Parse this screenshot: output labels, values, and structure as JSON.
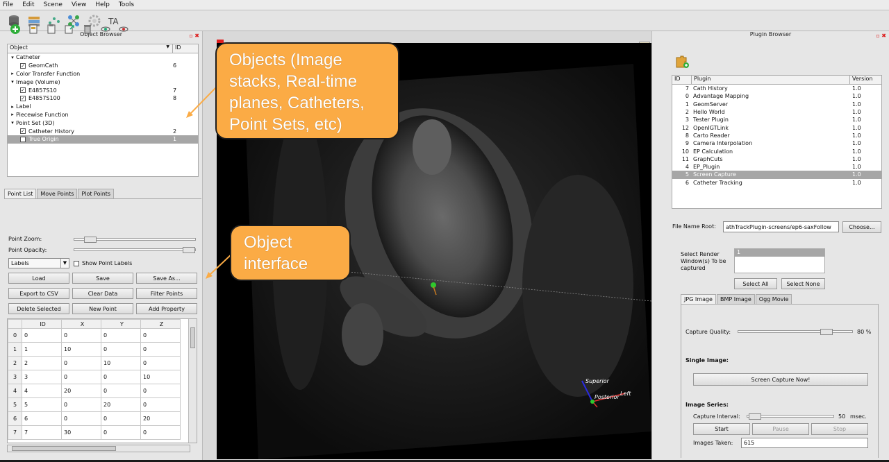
{
  "menu": [
    "File",
    "Edit",
    "Scene",
    "View",
    "Help",
    "Tools"
  ],
  "object_browser": {
    "title": "Object Browser",
    "columns": [
      "Object",
      "ID"
    ],
    "tree": [
      {
        "label": "Catheter",
        "level": 0,
        "arrow": "▾",
        "check": "",
        "id": ""
      },
      {
        "label": "GeomCath",
        "level": 1,
        "arrow": "",
        "check": "✓",
        "id": "6"
      },
      {
        "label": "Color Transfer Function",
        "level": 0,
        "arrow": "▸",
        "check": "",
        "id": ""
      },
      {
        "label": "Image (Volume)",
        "level": 0,
        "arrow": "▾",
        "check": "",
        "id": ""
      },
      {
        "label": "E4857S10",
        "level": 1,
        "arrow": "",
        "check": "✓",
        "id": "7"
      },
      {
        "label": "E4857S100",
        "level": 1,
        "arrow": "",
        "check": "✓",
        "id": "8"
      },
      {
        "label": "Label",
        "level": 0,
        "arrow": "▸",
        "check": "",
        "id": ""
      },
      {
        "label": "Piecewise Function",
        "level": 0,
        "arrow": "▸",
        "check": "",
        "id": ""
      },
      {
        "label": "Point Set (3D)",
        "level": 0,
        "arrow": "▾",
        "check": "",
        "id": ""
      },
      {
        "label": "Catheter History",
        "level": 1,
        "arrow": "",
        "check": "✓",
        "id": "2"
      },
      {
        "label": "True Origin",
        "level": 1,
        "arrow": "",
        "check": " ",
        "id": "1",
        "selected": true
      }
    ]
  },
  "point_panel": {
    "tabs": [
      "Point List",
      "Move Points",
      "Plot Points"
    ],
    "point_zoom_label": "Point Zoom:",
    "point_opacity_label": "Point Opacity:",
    "labels_combo": "Labels",
    "show_labels": "Show Point Labels",
    "buttons": {
      "load": "Load",
      "save": "Save",
      "save_as": "Save As...",
      "export_csv": "Export to CSV",
      "clear": "Clear Data",
      "filter": "Filter Points",
      "delete": "Delete Selected",
      "new_point": "New Point",
      "add_property": "Add Property"
    },
    "table": {
      "headers": [
        "ID",
        "X",
        "Y",
        "Z"
      ],
      "rows": [
        [
          "0",
          "0",
          "0",
          "0",
          "0"
        ],
        [
          "1",
          "1",
          "10",
          "0",
          "0"
        ],
        [
          "2",
          "2",
          "0",
          "10",
          "0"
        ],
        [
          "3",
          "3",
          "0",
          "0",
          "10"
        ],
        [
          "4",
          "4",
          "20",
          "0",
          "0"
        ],
        [
          "5",
          "5",
          "0",
          "20",
          "0"
        ],
        [
          "6",
          "6",
          "0",
          "0",
          "20"
        ],
        [
          "7",
          "7",
          "30",
          "0",
          "0"
        ]
      ]
    }
  },
  "viewport": {
    "orientation": {
      "superior": "Superior",
      "posterior": "Posterior",
      "left": "Left"
    }
  },
  "callouts": {
    "objects": [
      "Objects (Image",
      "stacks, Real-time",
      "planes, Catheters,",
      "Point Sets, etc)"
    ],
    "interface": [
      "Object",
      "interface"
    ]
  },
  "plugin_browser": {
    "title": "Plugin Browser",
    "columns": [
      "ID",
      "Plugin",
      "Version"
    ],
    "rows": [
      {
        "id": "7",
        "name": "Cath History",
        "ver": "1.0"
      },
      {
        "id": "0",
        "name": "Advantage Mapping",
        "ver": "1.0"
      },
      {
        "id": "1",
        "name": "GeomServer",
        "ver": "1.0"
      },
      {
        "id": "2",
        "name": "Hello World",
        "ver": "1.0"
      },
      {
        "id": "3",
        "name": "Tester Plugin",
        "ver": "1.0"
      },
      {
        "id": "12",
        "name": "OpenIGTLink",
        "ver": "1.0"
      },
      {
        "id": "8",
        "name": "Carto Reader",
        "ver": "1.0"
      },
      {
        "id": "9",
        "name": "Camera Interpolation",
        "ver": "1.0"
      },
      {
        "id": "10",
        "name": "EP Calculation",
        "ver": "1.0"
      },
      {
        "id": "11",
        "name": "GraphCuts",
        "ver": "1.0"
      },
      {
        "id": "4",
        "name": "EP_Plugin",
        "ver": "1.0"
      },
      {
        "id": "5",
        "name": "Screen Capture",
        "ver": "1.0",
        "selected": true
      },
      {
        "id": "6",
        "name": "Catheter Tracking",
        "ver": "1.0"
      }
    ]
  },
  "screen_capture": {
    "file_root_label": "File Name Root:",
    "file_root_value": "athTrackPlugin-screens/ep6-saxFollow",
    "choose": "Choose...",
    "select_render_label": "Select Render Window(s) To be captured",
    "render_list": [
      "1"
    ],
    "select_all": "Select All",
    "select_none": "Select None",
    "tabs": [
      "JPG Image",
      "BMP Image",
      "Ogg Movie"
    ],
    "quality_label": "Capture Quality:",
    "quality_value": 80,
    "quality_text": "80 %",
    "single_header": "Single Image:",
    "capture_now": "Screen Capture Now!",
    "series_header": "Image Series:",
    "interval_label": "Capture Interval:",
    "interval_value": "50",
    "interval_unit": "msec.",
    "start": "Start",
    "pause": "Pause",
    "stop": "Stop",
    "taken_label": "Images Taken:",
    "taken_value": "615"
  }
}
